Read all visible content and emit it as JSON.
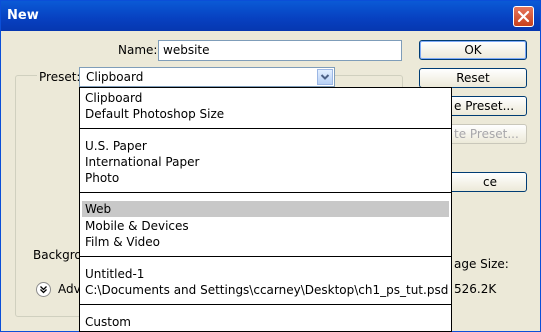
{
  "window": {
    "title": "New"
  },
  "form": {
    "name_label": "Name:",
    "name_value": "website",
    "preset_label": "Preset:",
    "preset_value": "Clipboard",
    "background_label_partial": "Backgrou",
    "advanced_label_partial": "Adva",
    "image_size_label_partial": "age Size:",
    "image_size_value_partial": "526.2K"
  },
  "buttons": {
    "ok": "OK",
    "reset": "Reset",
    "save_preset_partial": "e Preset...",
    "delete_preset_partial": "te Preset...",
    "device_central_partial": "ce Central..."
  },
  "dropdown": {
    "groups": [
      [
        "Clipboard",
        "Default Photoshop Size"
      ],
      [
        "U.S. Paper",
        "International Paper",
        "Photo"
      ],
      [
        "Web",
        "Mobile & Devices",
        "Film & Video"
      ],
      [
        "Untitled-1",
        "C:\\Documents and Settings\\ccarney\\Desktop\\ch1_ps_tut.psd"
      ],
      [
        "Custom"
      ]
    ],
    "highlighted": "Web"
  }
}
